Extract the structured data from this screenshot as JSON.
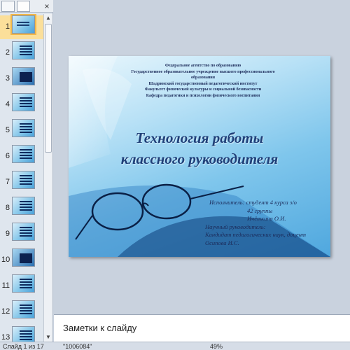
{
  "thumbnail_pane": {
    "close_symbol": "×",
    "slides": [
      {
        "num": "1",
        "style": "title",
        "selected": true
      },
      {
        "num": "2",
        "style": "lines"
      },
      {
        "num": "3",
        "style": "dark"
      },
      {
        "num": "4",
        "style": "lines"
      },
      {
        "num": "5",
        "style": "lines"
      },
      {
        "num": "6",
        "style": "lines"
      },
      {
        "num": "7",
        "style": "lines"
      },
      {
        "num": "8",
        "style": "lines"
      },
      {
        "num": "9",
        "style": "lines"
      },
      {
        "num": "10",
        "style": "dark"
      },
      {
        "num": "11",
        "style": "lines"
      },
      {
        "num": "12",
        "style": "lines"
      },
      {
        "num": "13",
        "style": "lines"
      }
    ]
  },
  "slide": {
    "header_lines": [
      "Федеральное агентство по образованию",
      "Государственное образовательное учреждение высшего профессионального",
      "образования",
      "Шадринский государственный педагогический институт",
      "Факультет физической культуры и социальной безопасности",
      "Кафедра педагогики и психологии физического воспитания"
    ],
    "title_line1": "Технология работы",
    "title_line2": "классного руководителя",
    "author_line1": "Исполнитель: студент 4 курса з/о",
    "author_line2": "42 группы",
    "author_line3": "Ичёткина О.И.",
    "author_line4": "Научный руководитель:",
    "author_line5": "Кандидат педагогических наук, доцент",
    "author_line6": "Осипова И.С."
  },
  "notes": {
    "placeholder": "Заметки к слайду"
  },
  "status_bar": {
    "slide_counter": "Слайд 1 из 17",
    "theme": "\"1006084\"",
    "zoom": "49%"
  }
}
